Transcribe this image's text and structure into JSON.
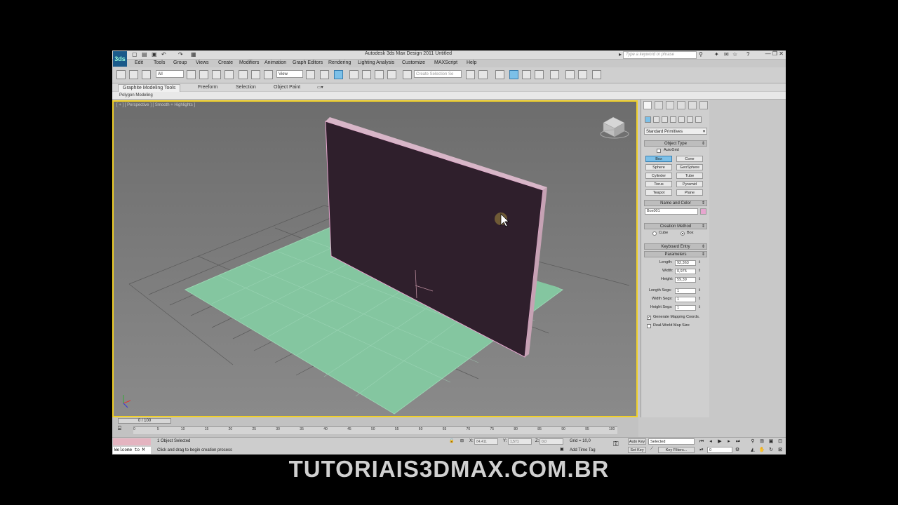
{
  "app": {
    "logo_text": "3ds",
    "title": "Autodesk 3ds Max Design 2011      Untitled",
    "search_placeholder": "Type a keyword or phrase",
    "window_buttons": "— ❐ ✕"
  },
  "menu": [
    "Edit",
    "Tools",
    "Group",
    "Views",
    "Create",
    "Modifiers",
    "Animation",
    "Graph Editors",
    "Rendering",
    "Lighting Analysis",
    "Customize",
    "MAXScript",
    "Help"
  ],
  "toolbar": {
    "filter_value": "All",
    "refcoord_value": "View",
    "named_selection_placeholder": "Create Selection Se"
  },
  "ribbon": {
    "tabs": [
      "Graphite Modeling Tools",
      "Freeform",
      "Selection",
      "Object Paint"
    ],
    "active_tab": "Graphite Modeling Tools",
    "sub_label": "Polygon Modeling"
  },
  "viewport": {
    "label": "[ + ] [ Perspective ] [ Smooth + Highlights ]",
    "colors": {
      "ground_plane": "#84c6a0",
      "box_object": "#2f1f2c",
      "border_active": "#f1d028"
    }
  },
  "command_panel": {
    "category_dropdown": "Standard Primitives",
    "object_type_title": "Object Type",
    "autogrid_label": "AutoGrid",
    "primitives": [
      "Box",
      "Cone",
      "Sphere",
      "GeoSphere",
      "Cylinder",
      "Tube",
      "Torus",
      "Pyramid",
      "Teapot",
      "Plane"
    ],
    "active_primitive": "Box",
    "name_color_title": "Name and Color",
    "object_name": "Box001",
    "object_color": "#e7a6cf",
    "creation_method_title": "Creation Method",
    "creation_cube": "Cube",
    "creation_box": "Box",
    "keyboard_entry_title": "Keyboard Entry",
    "parameters_title": "Parameters",
    "params": {
      "length_label": "Length:",
      "length": "92,363",
      "width_label": "Width:",
      "width": "0,975",
      "height_label": "Height:",
      "height": "59,39",
      "length_segs_label": "Length Segs:",
      "length_segs": "1",
      "width_segs_label": "Width Segs:",
      "width_segs": "1",
      "height_segs_label": "Height Segs:",
      "height_segs": "1"
    },
    "generate_mapping": "Generate Mapping Coords.",
    "real_world": "Real-World Map Size"
  },
  "timeline": {
    "frame_display": "0 / 100",
    "ticks": [
      "0",
      "5",
      "10",
      "15",
      "20",
      "25",
      "30",
      "35",
      "40",
      "45",
      "50",
      "55",
      "60",
      "65",
      "70",
      "75",
      "80",
      "85",
      "90",
      "95",
      "100"
    ]
  },
  "status": {
    "welcome": "Welcome to M",
    "selection_status": "1 Object Selected",
    "prompt": "Click and drag to begin creation process",
    "x_label": "X:",
    "x_value": "84,411",
    "y_label": "Y:",
    "y_value": "1,571",
    "z_label": "Z:",
    "z_value": "0,0",
    "grid": "Grid = 10,0",
    "add_time_tag": "Add Time Tag",
    "auto_key": "Auto Key",
    "selected_dropdown": "Selected",
    "set_key": "Set Key",
    "key_filters": "Key Filters...",
    "frame_field": "0"
  },
  "watermark": "TUTORIAIS3DMAX.COM.BR"
}
